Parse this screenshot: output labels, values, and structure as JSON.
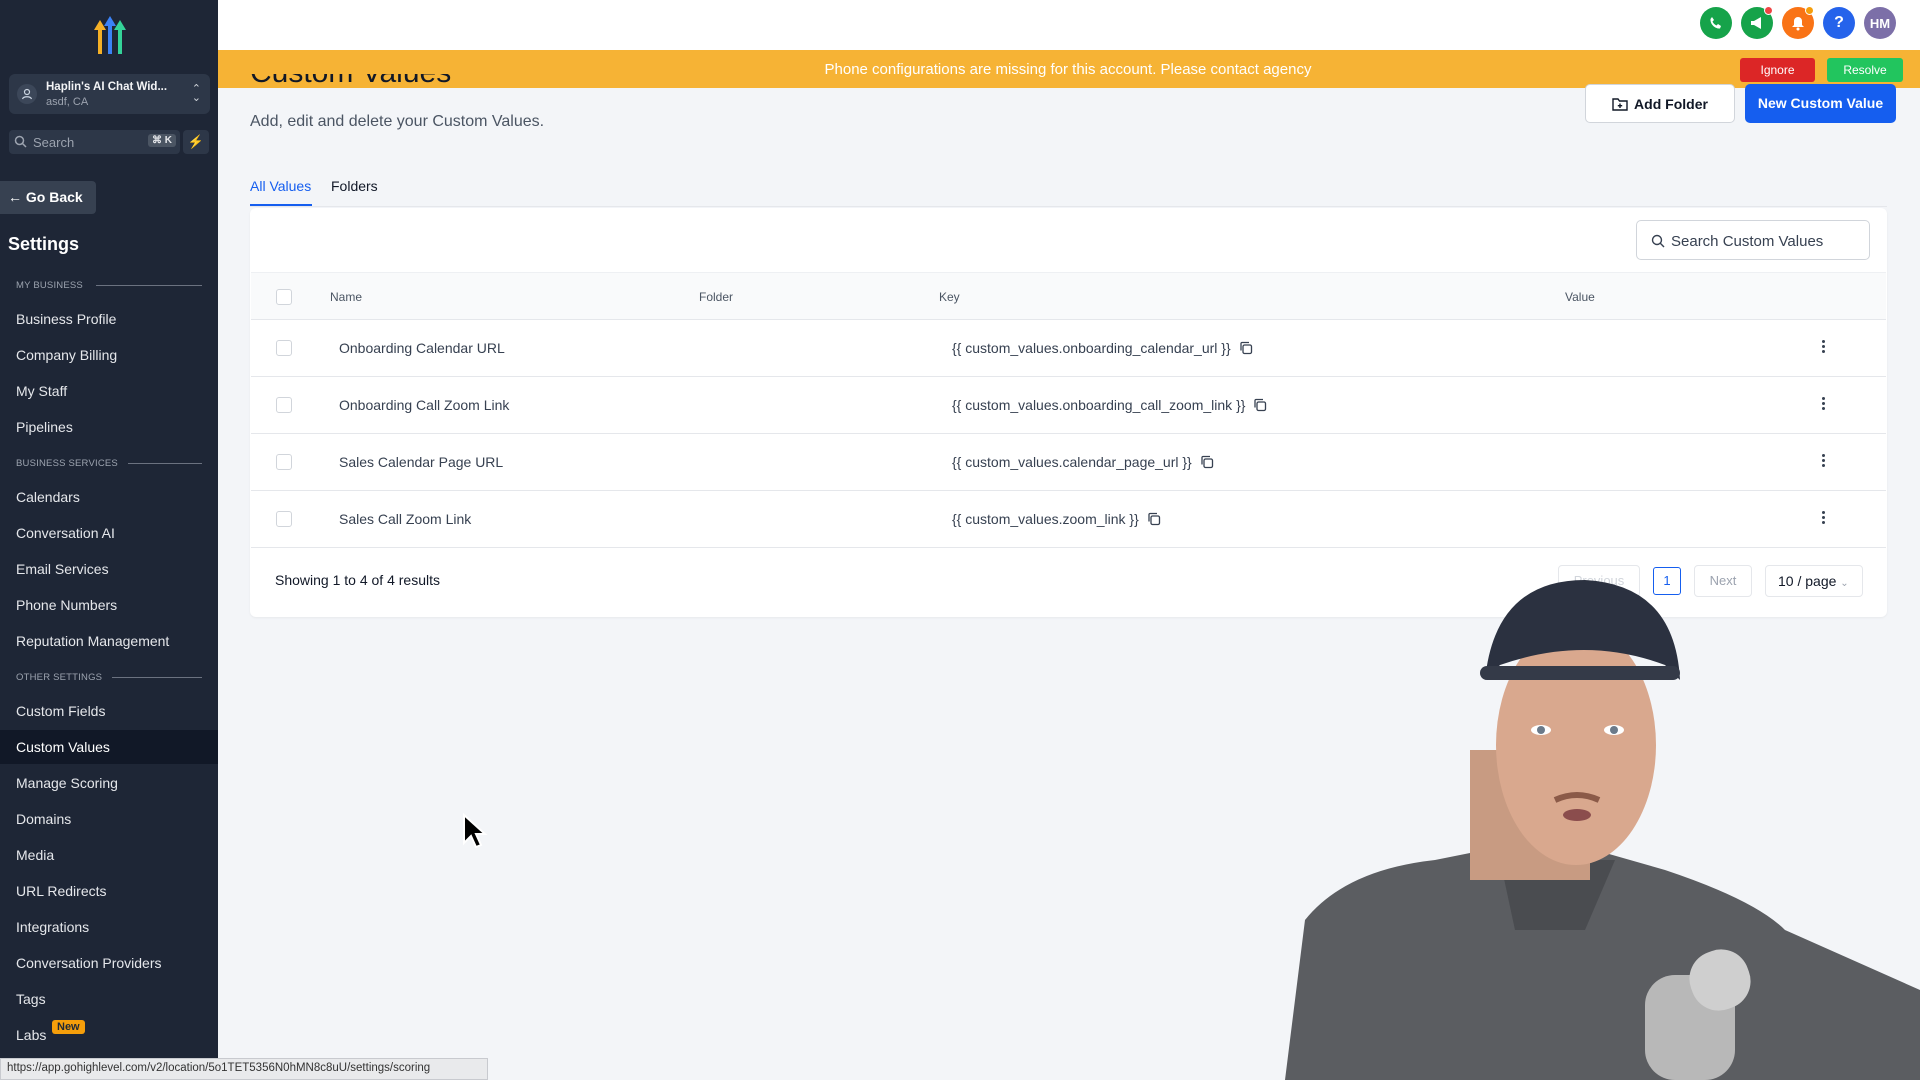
{
  "account": {
    "name": "Haplin's AI Chat Wid...",
    "location": "asdf, CA"
  },
  "sidebar": {
    "search_placeholder": "Search",
    "search_shortcut": "⌘ K",
    "go_back": "Go Back",
    "title": "Settings",
    "sections": {
      "my_business": "MY BUSINESS",
      "business_services": "BUSINESS SERVICES",
      "other_settings": "OTHER SETTINGS"
    },
    "items": [
      "Business Profile",
      "Company Billing",
      "My Staff",
      "Pipelines",
      "Calendars",
      "Conversation AI",
      "Email Services",
      "Phone Numbers",
      "Reputation Management",
      "Custom Fields",
      "Custom Values",
      "Manage Scoring",
      "Domains",
      "Media",
      "URL Redirects",
      "Integrations",
      "Conversation Providers",
      "Tags",
      "Labs"
    ],
    "labs_badge": "New",
    "active_item": "Custom Values"
  },
  "topbar": {
    "avatar_initials": "HM",
    "help": "?"
  },
  "banner": {
    "message": "Phone configurations are missing for this account. Please contact agency",
    "ignore": "Ignore",
    "resolve": "Resolve"
  },
  "page": {
    "title": "Custom Values",
    "subtitle": "Add, edit and delete your Custom Values.",
    "add_folder": "Add Folder",
    "new_custom_value": "New Custom Value",
    "tabs": [
      "All Values",
      "Folders"
    ],
    "search_placeholder": "Search Custom Values"
  },
  "table": {
    "headers": {
      "name": "Name",
      "folder": "Folder",
      "key": "Key",
      "value": "Value"
    },
    "rows": [
      {
        "name": "Onboarding Calendar URL",
        "key": "{{ custom_values.onboarding_calendar_url }}"
      },
      {
        "name": "Onboarding Call Zoom Link",
        "key": "{{ custom_values.onboarding_call_zoom_link }}"
      },
      {
        "name": "Sales Calendar Page URL",
        "key": "{{ custom_values.calendar_page_url }}"
      },
      {
        "name": "Sales Call Zoom Link",
        "key": "{{ custom_values.zoom_link }}"
      }
    ],
    "showing": "Showing 1 to 4 of 4 results",
    "previous": "Previous",
    "page": "1",
    "next": "Next",
    "per_page": "10 / page"
  },
  "status_url": "https://app.gohighlevel.com/v2/location/5o1TET5356N0hMN8c8uU/settings/scoring",
  "colors": {
    "accent": "#155eef",
    "sidebar": "#1e2636",
    "banner": "#f6b335"
  }
}
